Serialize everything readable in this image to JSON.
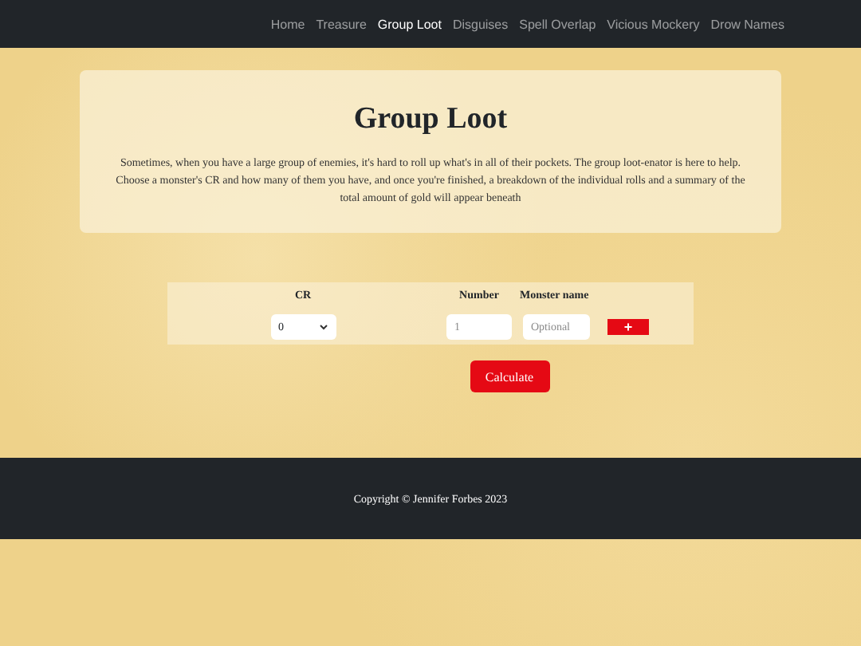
{
  "nav": [
    {
      "label": "Home",
      "selected": false
    },
    {
      "label": "Treasure",
      "selected": false
    },
    {
      "label": "Group Loot",
      "selected": true
    },
    {
      "label": "Disguises",
      "selected": false
    },
    {
      "label": "Spell Overlap",
      "selected": false
    },
    {
      "label": "Vicious Mockery",
      "selected": false
    },
    {
      "label": "Drow Names",
      "selected": false
    }
  ],
  "intro": {
    "title": "Group Loot",
    "text": "Sometimes, when you have a large group of enemies, it's hard to roll up what's in all of their pockets. The group loot-enator is here to help. Choose a monster's CR and how many of them you have, and once you're finished, a breakdown of the individual rolls and a summary of the total amount of gold will appear beneath"
  },
  "form": {
    "columns": [
      "CR",
      "Number",
      "Monster name"
    ],
    "row": {
      "cr": "0",
      "number": {
        "placeholder": "1"
      },
      "name": {
        "placeholder": "Optional"
      },
      "add_button": "+"
    },
    "calculate_button": "Calculate"
  },
  "footer": {
    "text": "Copyright © Jennifer Forbes 2023"
  }
}
